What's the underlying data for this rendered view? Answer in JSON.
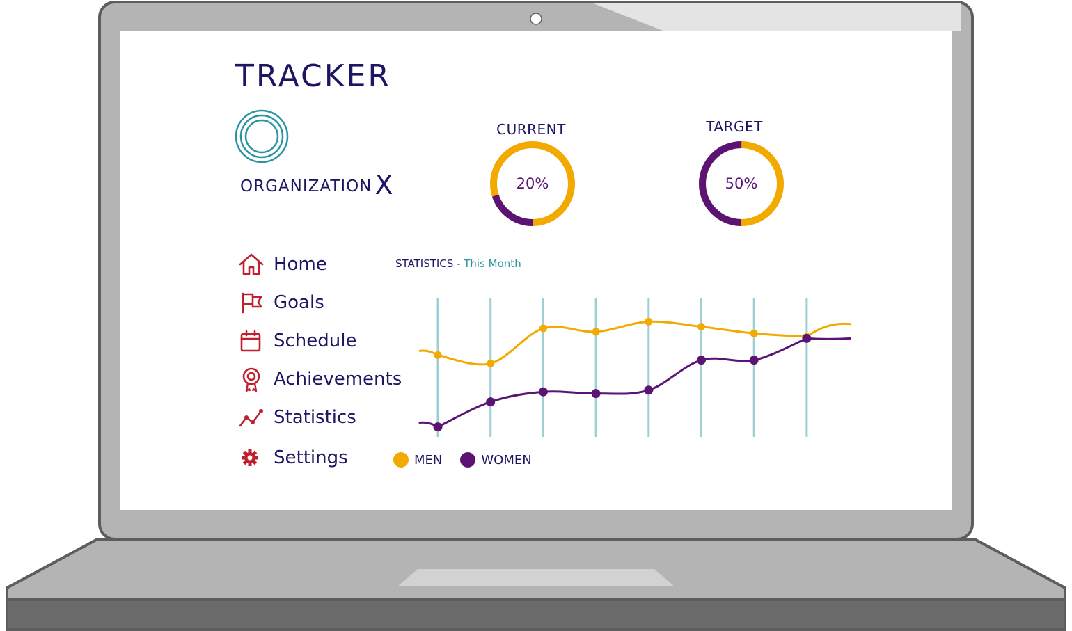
{
  "app": {
    "title": "TRACKER",
    "organization": "ORGANIZATION",
    "organization_suffix": "X",
    "logo_icon": "concentric-circles-icon"
  },
  "colors": {
    "men": "#f2aa00",
    "women": "#5b1473",
    "navy": "#1c1763",
    "nav_icon": "#c0202e",
    "grid": "#9fcfd6",
    "accent": "#2a94a3"
  },
  "gauges": {
    "current": {
      "label": "CURRENT",
      "value": "20%",
      "fraction": 0.2
    },
    "target": {
      "label": "TARGET",
      "value": "50%",
      "fraction": 0.5
    }
  },
  "nav": {
    "items": [
      {
        "label": "Home",
        "icon": "home-icon"
      },
      {
        "label": "Goals",
        "icon": "flag-icon"
      },
      {
        "label": "Schedule",
        "icon": "calendar-icon"
      },
      {
        "label": "Achievements",
        "icon": "award-icon"
      },
      {
        "label": "Statistics",
        "icon": "line-chart-icon"
      },
      {
        "label": "Settings",
        "icon": "gear-icon"
      }
    ]
  },
  "stats": {
    "title": "STATISTICS",
    "separator": " - ",
    "subtitle": "This Month"
  },
  "chart_data": {
    "type": "line",
    "x": [
      1,
      2,
      3,
      4,
      5,
      6,
      7,
      8
    ],
    "series": [
      {
        "name": "MEN",
        "values": [
          64,
          59,
          80,
          78,
          84,
          81,
          77,
          75
        ]
      },
      {
        "name": "WOMEN",
        "values": [
          21,
          36,
          42,
          41,
          43,
          61,
          61,
          74
        ]
      }
    ],
    "ylim": [
      0,
      100
    ],
    "grid": "vertical",
    "legend_position": "bottom-left"
  }
}
